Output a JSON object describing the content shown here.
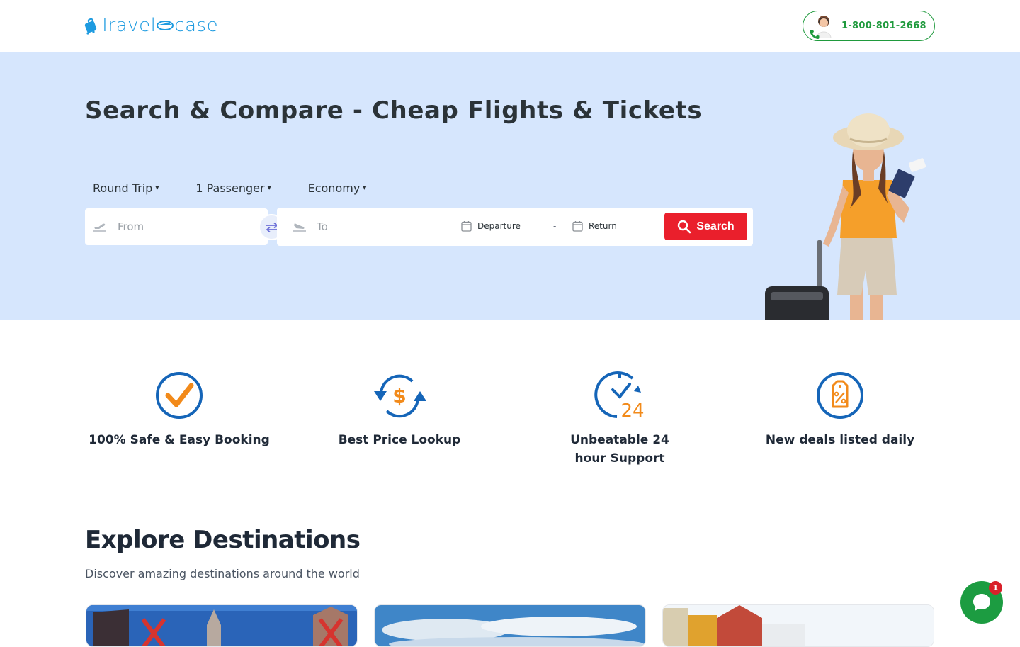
{
  "header": {
    "logo_text_left": "Travel",
    "logo_text_right": "case",
    "phone": "1-800-801-2668"
  },
  "hero": {
    "title": "Search & Compare - Cheap Flights & Tickets",
    "options": {
      "trip_type": "Round Trip",
      "passengers": "1 Passenger",
      "cabin": "Economy"
    },
    "from_placeholder": "From",
    "to_placeholder": "To",
    "departure_label": "Departure",
    "date_separator": "-",
    "return_label": "Return",
    "search_label": "Search"
  },
  "features": [
    {
      "label": "100% Safe & Easy Booking",
      "icon": "check-circle-icon"
    },
    {
      "label": "Best Price Lookup",
      "icon": "price-refresh-icon"
    },
    {
      "label": "Unbeatable 24 hour Support",
      "icon": "clock-24-icon"
    },
    {
      "label": "New deals listed daily",
      "icon": "discount-tag-icon"
    }
  ],
  "explore": {
    "title": "Explore Destinations",
    "subtitle": "Discover amazing destinations around the world"
  },
  "chat": {
    "badge": "1"
  },
  "colors": {
    "brand_blue": "#1e9be0",
    "hero_bg": "#d6e6fd",
    "search_red": "#ea1f2c",
    "phone_green": "#1f9a3d",
    "icon_blue": "#1565b8",
    "icon_orange": "#f28a1a"
  }
}
